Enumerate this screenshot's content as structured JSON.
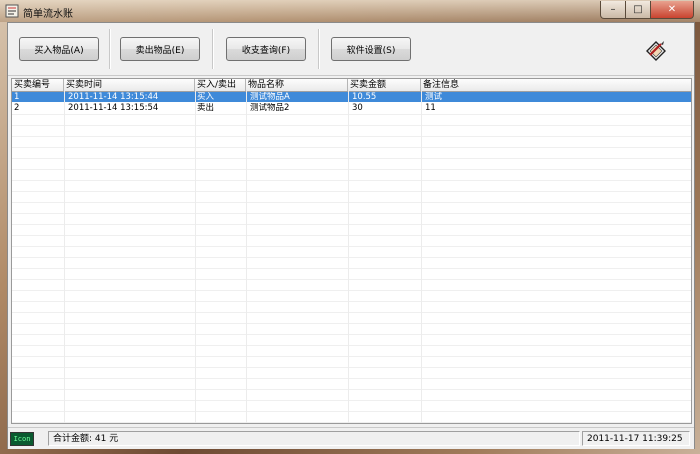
{
  "window": {
    "title": "简单流水账",
    "controls": {
      "minimize": "–",
      "maximize": "□",
      "close": "✕"
    }
  },
  "toolbar": {
    "buttons": [
      {
        "label": "买入物品(A)"
      },
      {
        "label": "卖出物品(E)"
      },
      {
        "label": "收支查询(F)"
      },
      {
        "label": "软件设置(S)"
      }
    ],
    "logo_icon": "pen-notepad-icon"
  },
  "table": {
    "columns": [
      "买卖编号",
      "买卖时间",
      "买入/卖出",
      "物品名称",
      "买卖金额",
      "备注信息"
    ],
    "rows": [
      {
        "id": "1",
        "time": "2011-11-14 13:15:44",
        "type": "买入",
        "name": "测试物品A",
        "amount": "10.55",
        "note": "测试",
        "selected": true
      },
      {
        "id": "2",
        "time": "2011-11-14 13:15:54",
        "type": "卖出",
        "name": "测试物品2",
        "amount": "30",
        "note": "11",
        "selected": false
      }
    ]
  },
  "status": {
    "app_badge": "Icon",
    "total_label": "合计金额: 41 元",
    "datetime": "2011-11-17  11:39:25"
  },
  "colors": {
    "selection": "#3f8ad9",
    "close_button": "#c9432f"
  }
}
